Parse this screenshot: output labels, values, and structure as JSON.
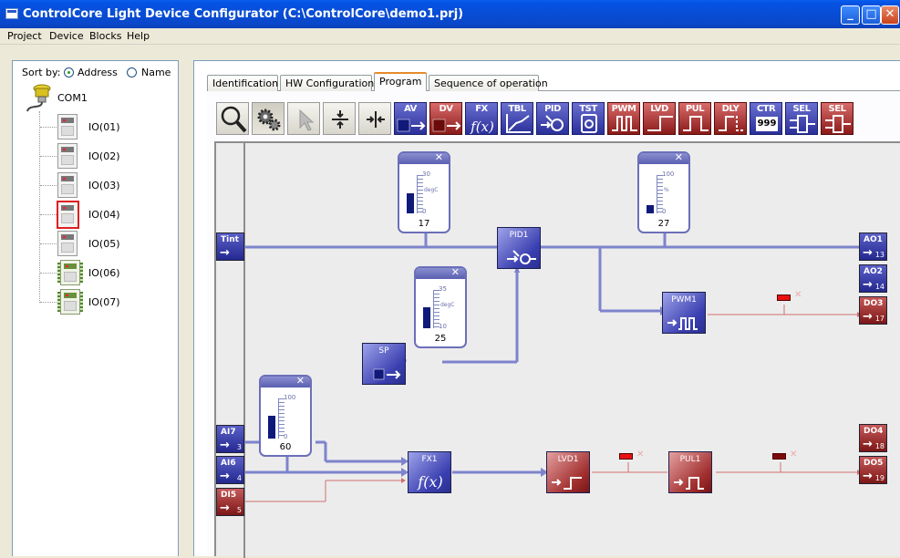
{
  "window": {
    "title": "ControlCore Light Device Configurator (C:\\ControlCore\\demo1.prj)",
    "min": "_",
    "max": "□",
    "close": "✕"
  },
  "menu": [
    "Project",
    "Device",
    "Blocks",
    "Help"
  ],
  "sidebar": {
    "sort_label": "Sort by:",
    "sort_options": [
      "Address",
      "Name"
    ],
    "sort_selected": "Address",
    "root": "COM1",
    "devices": [
      {
        "label": "IO(01)",
        "kind": "gray"
      },
      {
        "label": "IO(02)",
        "kind": "gray"
      },
      {
        "label": "IO(03)",
        "kind": "gray"
      },
      {
        "label": "IO(04)",
        "kind": "gray",
        "selected": true
      },
      {
        "label": "IO(05)",
        "kind": "gray"
      },
      {
        "label": "IO(06)",
        "kind": "green"
      },
      {
        "label": "IO(07)",
        "kind": "green"
      }
    ]
  },
  "tabs": [
    "Identification",
    "HW Configuration",
    "Program",
    "Sequence of operation"
  ],
  "active_tab": "Program",
  "toolbar": [
    {
      "name": "zoom",
      "label": "",
      "icon": "magnifier-icon",
      "style": "plain"
    },
    {
      "name": "settings",
      "label": "",
      "icon": "gears-icon",
      "style": "pressed"
    },
    {
      "name": "select",
      "label": "",
      "icon": "pointer-icon",
      "style": "plain"
    },
    {
      "name": "split-h",
      "label": "",
      "icon": "split-vertical-icon",
      "style": "plain"
    },
    {
      "name": "split-v",
      "label": "",
      "icon": "split-horizontal-icon",
      "style": "plain"
    },
    {
      "name": "av",
      "label": "AV",
      "icon": "analog-value-icon",
      "style": "blue"
    },
    {
      "name": "dv",
      "label": "DV",
      "icon": "digital-value-icon",
      "style": "red"
    },
    {
      "name": "fx",
      "label": "FX",
      "icon": "function-icon",
      "style": "blue"
    },
    {
      "name": "tbl",
      "label": "TBL",
      "icon": "table-curve-icon",
      "style": "blue"
    },
    {
      "name": "pid",
      "label": "PID",
      "icon": "pid-icon",
      "style": "blue"
    },
    {
      "name": "tst",
      "label": "TST",
      "icon": "thermostat-icon",
      "style": "blue"
    },
    {
      "name": "pwm",
      "label": "PWM",
      "icon": "pwm-icon",
      "style": "red"
    },
    {
      "name": "lvd",
      "label": "LVD",
      "icon": "level-detector-icon",
      "style": "red"
    },
    {
      "name": "pul",
      "label": "PUL",
      "icon": "pulse-icon",
      "style": "red"
    },
    {
      "name": "dly",
      "label": "DLY",
      "icon": "delay-icon",
      "style": "red"
    },
    {
      "name": "ctr",
      "label": "CTR",
      "icon": "counter-icon",
      "style": "blue",
      "counter_text": "999"
    },
    {
      "name": "sel-a",
      "label": "SEL",
      "icon": "selector-analog-icon",
      "style": "blue"
    },
    {
      "name": "sel-d",
      "label": "SEL",
      "icon": "selector-digital-icon",
      "style": "red"
    }
  ],
  "program": {
    "inputs": [
      {
        "name": "Tint",
        "num": "",
        "color": "blue"
      },
      {
        "name": "AI7",
        "num": "3",
        "color": "blue"
      },
      {
        "name": "AI6",
        "num": "4",
        "color": "blue"
      },
      {
        "name": "DI5",
        "num": "5",
        "color": "red"
      }
    ],
    "outputs": [
      {
        "name": "AO1",
        "num": "13",
        "color": "blue"
      },
      {
        "name": "AO2",
        "num": "14",
        "color": "blue"
      },
      {
        "name": "DO3",
        "num": "17",
        "color": "red"
      },
      {
        "name": "DO4",
        "num": "18",
        "color": "red"
      },
      {
        "name": "DO5",
        "num": "19",
        "color": "red"
      }
    ],
    "blocks": [
      {
        "name": "PID1",
        "color": "blue",
        "icon": "pid-icon"
      },
      {
        "name": "SP",
        "color": "blue",
        "icon": "analog-value-icon"
      },
      {
        "name": "PWM1",
        "color": "blue",
        "icon": "pwm-icon"
      },
      {
        "name": "FX1",
        "color": "blue",
        "icon": "function-icon"
      },
      {
        "name": "LVD1",
        "color": "red",
        "icon": "level-detector-icon"
      },
      {
        "name": "PUL1",
        "color": "red",
        "icon": "pulse-icon"
      }
    ],
    "gauges": [
      {
        "value": "17",
        "max": "30",
        "min": "0",
        "unit": "degC",
        "level": 0.57
      },
      {
        "value": "27",
        "max": "100",
        "min": "0",
        "unit": "%",
        "level": 0.27
      },
      {
        "value": "25",
        "max": "35",
        "min": "10",
        "unit": "degC",
        "level": 0.6
      },
      {
        "value": "60",
        "max": "100",
        "min": "0",
        "unit": "",
        "level": 0.6
      }
    ],
    "indicators": [
      {
        "color": "#e81010"
      },
      {
        "color": "#e81010"
      },
      {
        "color": "#7a0a0a"
      }
    ]
  }
}
